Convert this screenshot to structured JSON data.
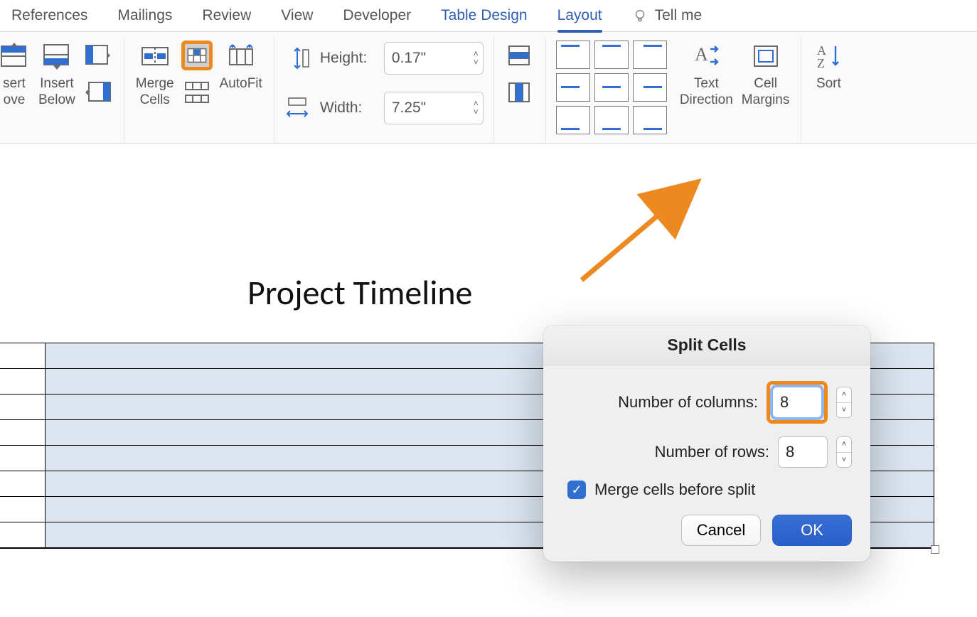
{
  "tabs": {
    "references": "References",
    "mailings": "Mailings",
    "review": "Review",
    "view": "View",
    "developer": "Developer",
    "table_design": "Table Design",
    "layout": "Layout",
    "tell_me": "Tell me"
  },
  "ribbon": {
    "insert_above_1": "sert",
    "insert_above_2": "ove",
    "insert_below_1": "Insert",
    "insert_below_2": "Below",
    "merge_cells_1": "Merge",
    "merge_cells_2": "Cells",
    "autofit": "AutoFit",
    "height_label": "Height:",
    "height_value": "0.17\"",
    "width_label": "Width:",
    "width_value": "7.25\"",
    "text_direction_1": "Text",
    "text_direction_2": "Direction",
    "cell_margins_1": "Cell",
    "cell_margins_2": "Margins",
    "sort": "Sort"
  },
  "document": {
    "title": "Project Timeline",
    "table_rows": 8
  },
  "dialog": {
    "title": "Split Cells",
    "columns_label": "Number of columns:",
    "columns_value": "8",
    "rows_label": "Number of rows:",
    "rows_value": "8",
    "merge_checkbox": "Merge cells before split",
    "cancel": "Cancel",
    "ok": "OK"
  }
}
